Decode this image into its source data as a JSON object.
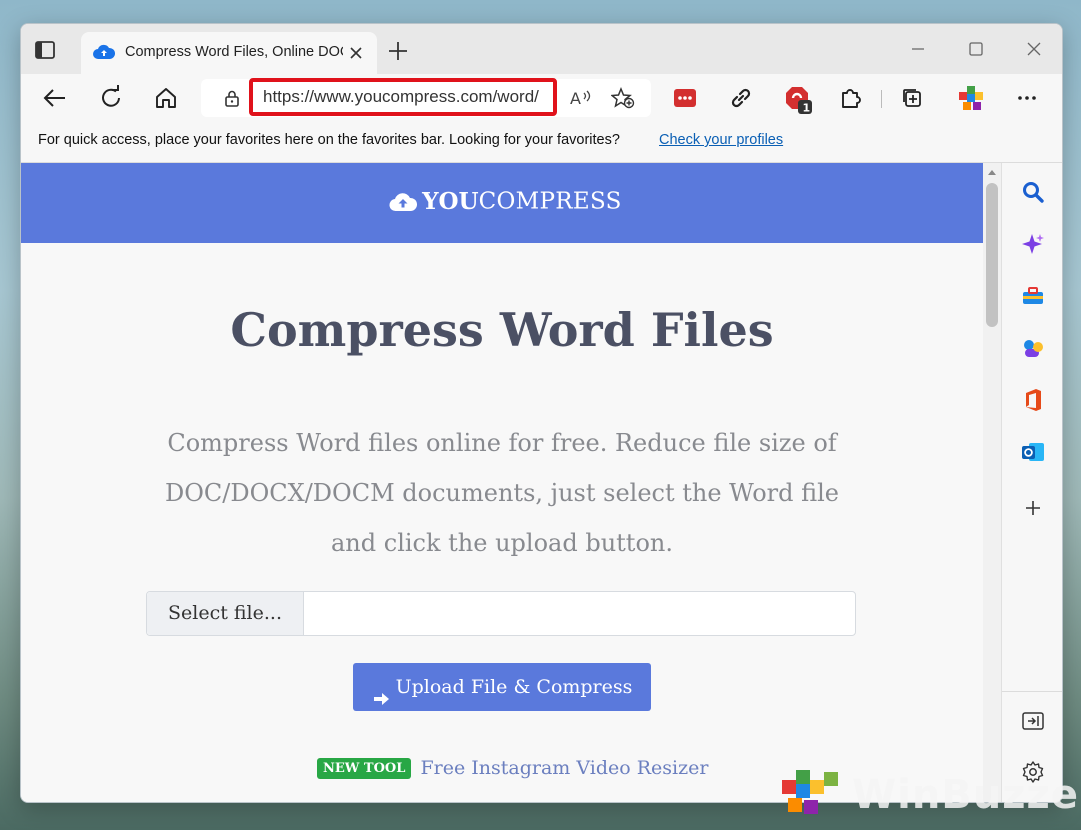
{
  "browser": {
    "tab": {
      "title": "Compress Word Files, Online DOC"
    },
    "address_bar": {
      "url": "https://www.youcompress.com/word/"
    },
    "favorites_bar": {
      "message": "For quick access, place your favorites here on the favorites bar. Looking for your favorites?",
      "link": "Check your profiles"
    },
    "extension_badge": "1",
    "highlight_color": "#e0121b"
  },
  "page": {
    "brand": {
      "bold": "YOU",
      "regular": "COMPRESS",
      "banner_color": "#5a79dc"
    },
    "heading": "Compress Word Files",
    "description": "Compress Word files online for free. Reduce file size of DOC/DOCX/DOCM documents, just select the Word file and click the upload button.",
    "file_picker": {
      "button": "Select file..."
    },
    "upload_button": "Upload File & Compress",
    "new_tool": {
      "badge": "NEW TOOL",
      "link": "Free Instagram Video Resizer"
    }
  },
  "sidebar": {
    "icons": [
      "search-icon",
      "copilot-sparkle-icon",
      "tools-icon",
      "games-icon",
      "office-icon",
      "outlook-icon",
      "add-icon",
      "hide-sidebar-icon",
      "settings-icon"
    ]
  },
  "watermark": {
    "text": "WinBuzzer"
  }
}
